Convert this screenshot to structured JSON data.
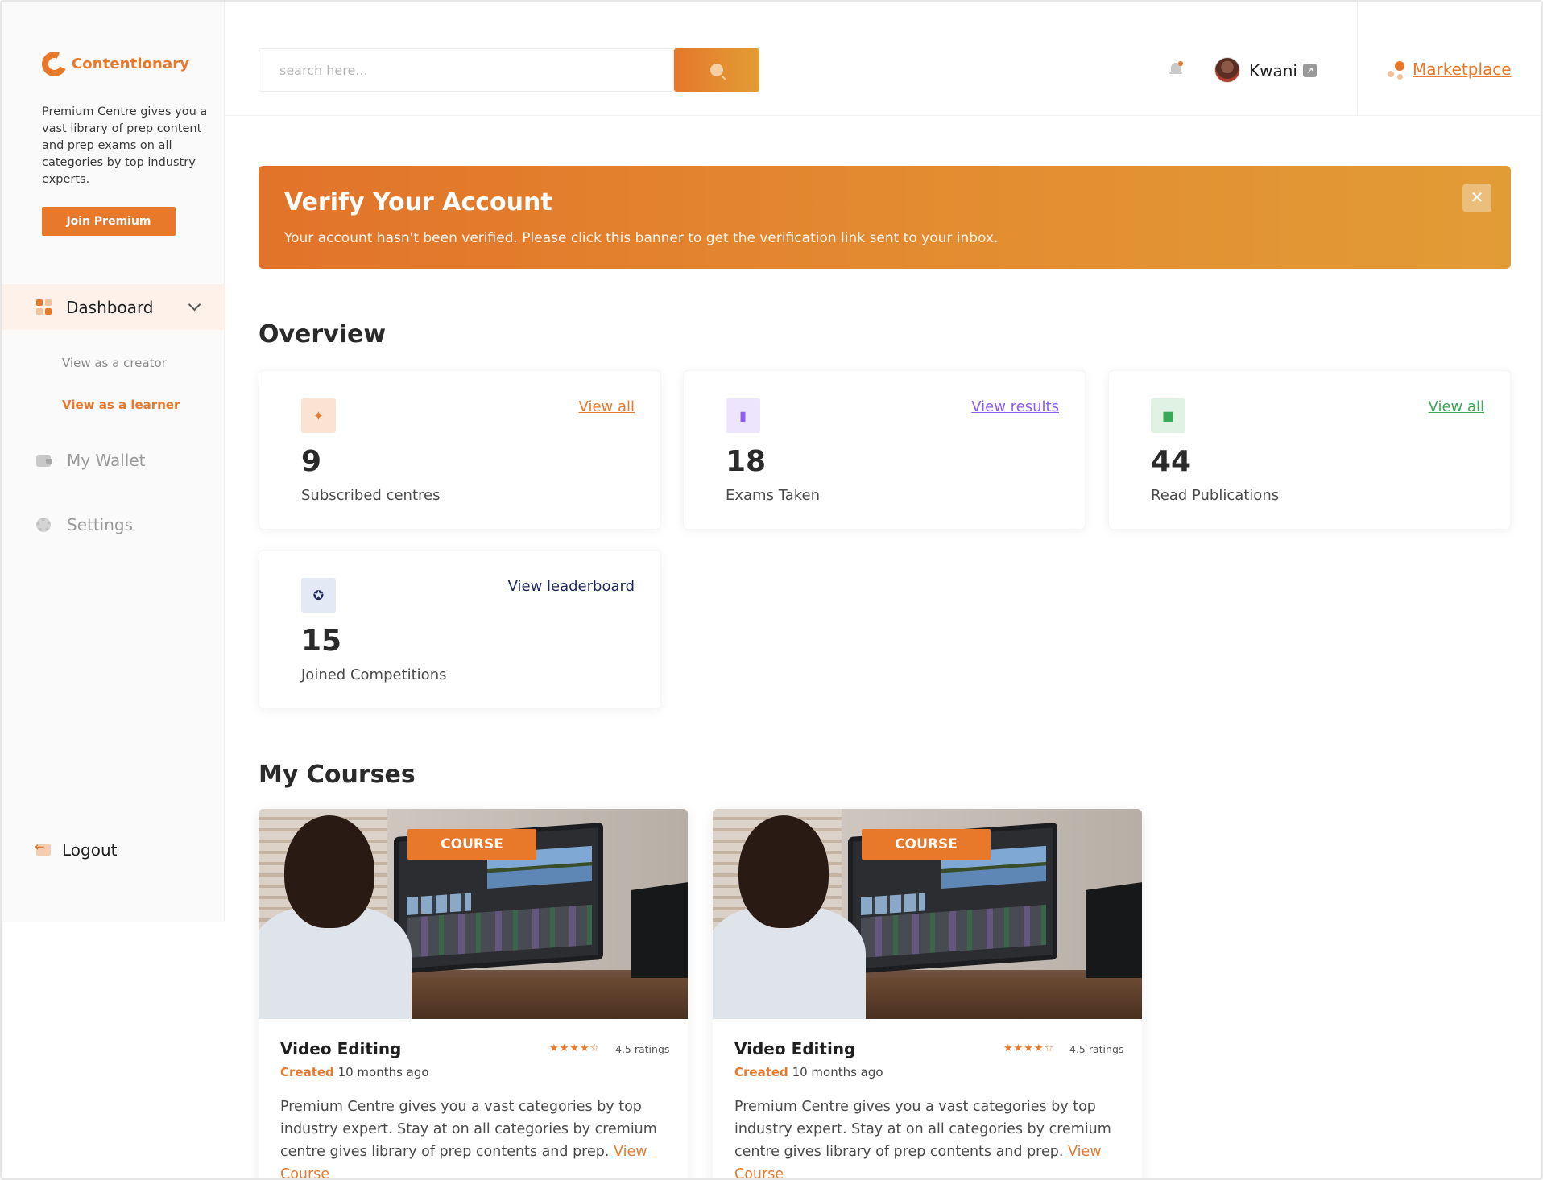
{
  "sidebar": {
    "brand": "Contentionary",
    "promo": "Premium Centre gives you a vast library of prep content and prep exams on all categories by top industry experts.",
    "join_label": "Join Premium",
    "dashboard_label": "Dashboard",
    "dashboard_sub": [
      "View as a creator",
      "View as a learner"
    ],
    "wallet_label": "My Wallet",
    "settings_label": "Settings",
    "logout_label": "Logout"
  },
  "header": {
    "search_placeholder": "search here...",
    "user_name": "Kwani",
    "marketplace_label": "Marketplace"
  },
  "banner": {
    "title": "Verify Your Account",
    "text": "Your account hasn't been verified. Please click this banner to get the verification link sent to your inbox.",
    "close_glyph": "✕"
  },
  "overview": {
    "title": "Overview",
    "cards": [
      {
        "value": "9",
        "label": "Subscribed centres",
        "link": "View all",
        "accent": "#e8782a",
        "icon": "compass-icon"
      },
      {
        "value": "18",
        "label": "Exams Taken",
        "link": "View results",
        "accent": "#8b5cf6",
        "icon": "book-icon"
      },
      {
        "value": "44",
        "label": "Read Publications",
        "link": "View all",
        "accent": "#3aa858",
        "icon": "bookmark-icon"
      },
      {
        "value": "15",
        "label": "Joined Competitions",
        "link": "View leaderboard",
        "accent": "#1e2a5a",
        "icon": "award-icon"
      }
    ]
  },
  "courses": {
    "title": "My Courses",
    "items": [
      {
        "badge": "COURSE",
        "title": "Video Editing",
        "stars": "★★★★☆",
        "rating": "4.5 ratings",
        "created_key": "Created",
        "created_value": " 10 months ago",
        "description": "Premium Centre gives you a vast categories by top industry expert. Stay at on all categories by cremium centre gives library of prep contents and prep. ",
        "view_link": "View Course"
      },
      {
        "badge": "COURSE",
        "title": "Video Editing",
        "stars": "★★★★☆",
        "rating": "4.5 ratings",
        "created_key": "Created",
        "created_value": " 10 months ago",
        "description": "Premium Centre gives you a vast categories by top industry expert. Stay at on all categories by cremium centre gives library of prep contents and prep. ",
        "view_link": "View Course"
      }
    ]
  },
  "colors": {
    "accent": "#e8782a",
    "sidebar_active_bg": "#fdf1e9"
  }
}
